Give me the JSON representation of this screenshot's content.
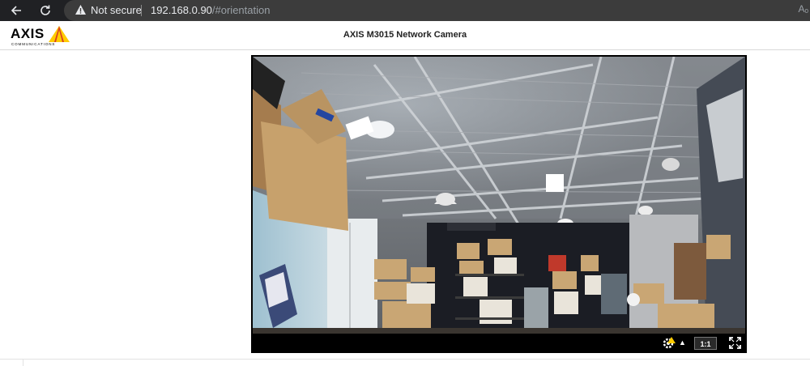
{
  "browser": {
    "security_label": "Not secure",
    "url_host": "192.168.0.90",
    "url_path": "/#orientation",
    "reader_icon": "Aₒ"
  },
  "header": {
    "logo_text": "AXIS",
    "logo_subtext": "COMMUNICATIONS",
    "title": "AXIS M3015 Network Camera"
  },
  "video": {
    "scene": "warehouse-ceiling-live-view",
    "controls": {
      "overlay_icon": "gear-warning-icon",
      "ratio_label": "1:1",
      "fullscreen_icon": "fullscreen-icon"
    }
  },
  "colors": {
    "browser_bg": "#202124",
    "omnibox_bg": "#3c3c3c",
    "axis_yellow": "#ffcc00",
    "axis_red": "#d1232a"
  }
}
